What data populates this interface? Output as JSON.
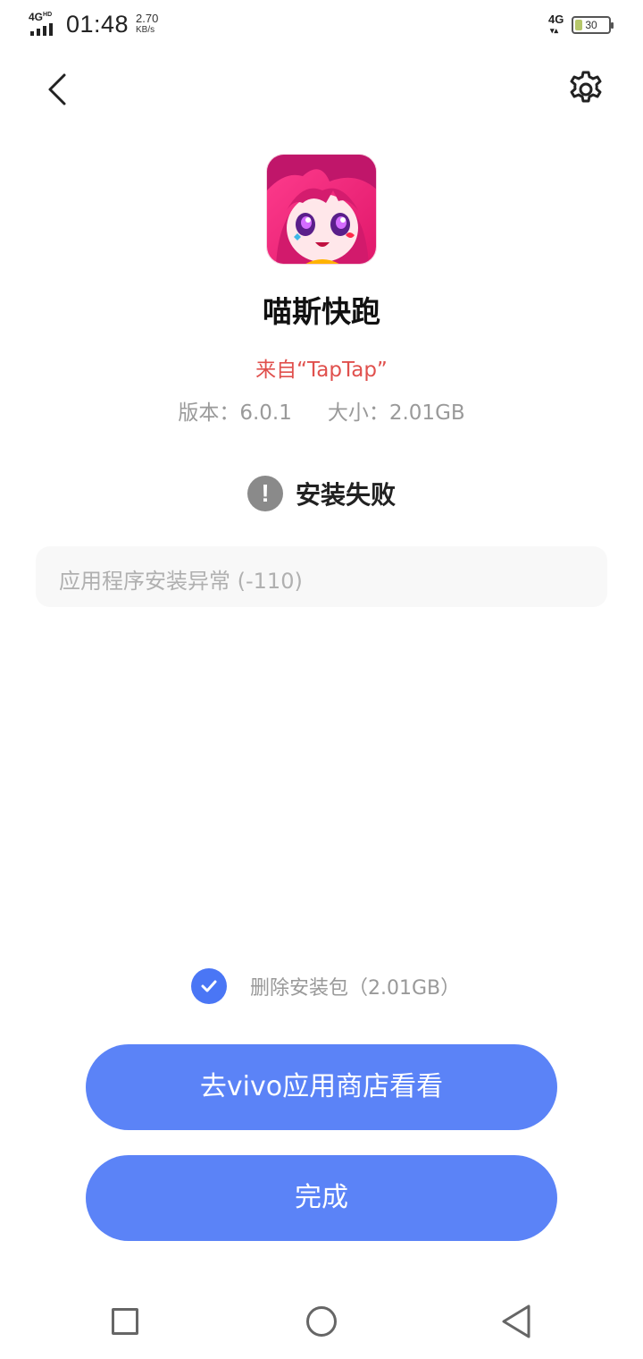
{
  "status_bar": {
    "network_left": "4G",
    "network_left_sup": "HD",
    "time": "01:48",
    "speed_value": "2.70",
    "speed_unit": "KB/s",
    "network_right": "4G",
    "network_right_arrows": "▾▴",
    "battery_percent": "30",
    "battery_level": 0.3
  },
  "header": {
    "back_icon": "chevron-left-icon",
    "settings_icon": "gear-icon"
  },
  "app": {
    "name": "喵斯快跑",
    "source": "来自“TapTap”",
    "version": "版本：6.0.1",
    "size": "大小：2.01GB"
  },
  "install_status": {
    "icon_glyph": "!",
    "text": "安装失败",
    "error_message": "应用程序安装异常 (-110)"
  },
  "delete_package": {
    "checked": true,
    "label": "删除安装包（2.01GB）"
  },
  "buttons": {
    "store_label": "去vivo应用商店看看",
    "done_label": "完成"
  },
  "colors": {
    "accent": "#5b83f7",
    "checkbox": "#4a76f5",
    "source_red": "#e0504d",
    "muted": "#9a9a9a"
  },
  "nav_bar": {
    "recent_icon": "square-icon",
    "home_icon": "circle-icon",
    "back_icon": "triangle-back-icon"
  }
}
